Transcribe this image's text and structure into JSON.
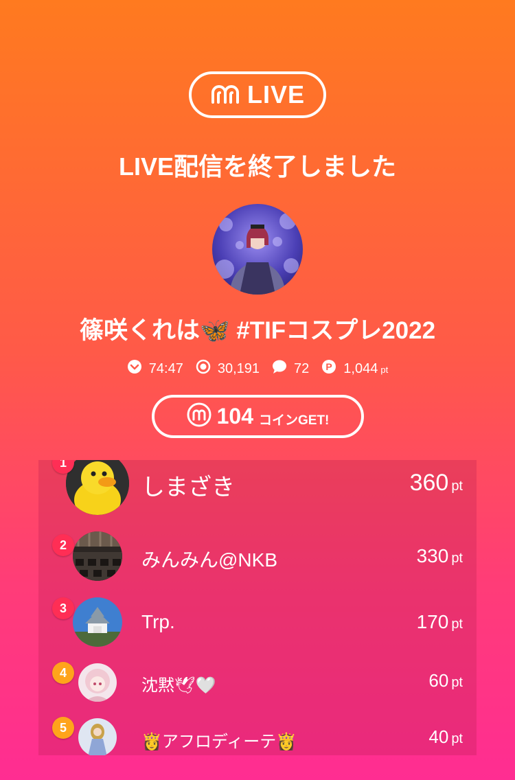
{
  "header": {
    "logo_text": "LIVE",
    "headline": "LIVE配信を終了しました"
  },
  "streamer": {
    "name": "篠咲くれは🦋 #TIFコスプレ2022"
  },
  "stats": {
    "duration": "74:47",
    "viewers": "30,191",
    "comments": "72",
    "points": "1,044",
    "points_unit": "pt"
  },
  "coins": {
    "amount": "104",
    "suffix": "コインGET!"
  },
  "ranking": [
    {
      "rank": "1",
      "name": "しまざき",
      "points": "360",
      "unit": "pt"
    },
    {
      "rank": "2",
      "name": "みんみん@NKB",
      "points": "330",
      "unit": "pt"
    },
    {
      "rank": "3",
      "name": "Trp.",
      "points": "170",
      "unit": "pt"
    },
    {
      "rank": "4",
      "name": "沈黙🕊🤍",
      "points": "60",
      "unit": "pt"
    },
    {
      "rank": "5",
      "name": "👸アフロディーテ👸",
      "points": "40",
      "unit": "pt"
    }
  ],
  "colors": {
    "rank_badge_red": "#ff2e55",
    "rank_badge_orange": "#ffa41b",
    "gradient_top": "#ff7a1f",
    "gradient_bottom": "#ff2d92"
  },
  "icons": {
    "logo": "m-logo-icon",
    "duration": "chevron-circle-icon",
    "viewers": "viewers-icon",
    "comments": "comment-bubble-icon",
    "points": "point-p-icon",
    "coin": "m-coin-icon"
  }
}
